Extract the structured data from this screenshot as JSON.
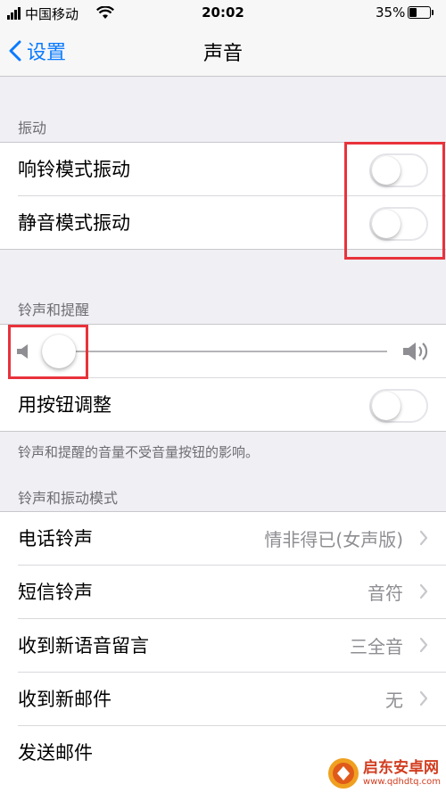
{
  "status_bar": {
    "carrier": "中国移动",
    "time": "20:02",
    "battery": "35%"
  },
  "nav": {
    "back_label": "设置",
    "title": "声音"
  },
  "vibrate_section": {
    "header": "振动",
    "rows": [
      {
        "label": "响铃模式振动",
        "toggle_on": false
      },
      {
        "label": "静音模式振动",
        "toggle_on": false
      }
    ]
  },
  "ringer_section": {
    "header": "铃声和提醒",
    "volume_level": 0.05,
    "change_with_buttons": {
      "label": "用按钮调整",
      "toggle_on": false
    },
    "footnote": "铃声和提醒的音量不受音量按钮的影响。"
  },
  "patterns_section": {
    "header": "铃声和振动模式",
    "rows": [
      {
        "label": "电话铃声",
        "value": "情非得已(女声版)"
      },
      {
        "label": "短信铃声",
        "value": "音符"
      },
      {
        "label": "收到新语音留言",
        "value": "三全音"
      },
      {
        "label": "收到新邮件",
        "value": "无"
      },
      {
        "label": "发送邮件",
        "value": ""
      }
    ]
  },
  "watermark": {
    "text_cn": "启东安卓网",
    "text_url": "www.qdhdtq.com"
  },
  "colors": {
    "accent": "#0a7aff",
    "annotation": "#e8323c",
    "background": "#efeff4"
  }
}
